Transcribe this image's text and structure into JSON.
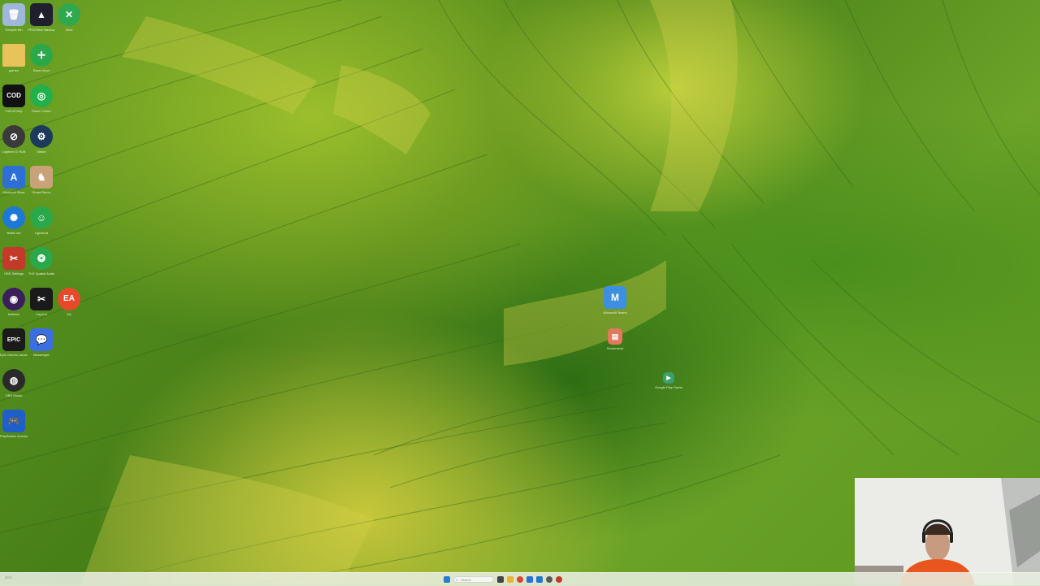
{
  "desktop": {
    "icons": [
      {
        "label": "Recycle Bin",
        "icon": "recycle-bin-icon",
        "color": "#9fb7d8",
        "glyph": "🗑"
      },
      {
        "label": "PROXMox Backup",
        "icon": "triangle-app-icon",
        "color": "#1f1f2e",
        "glyph": "▲"
      },
      {
        "label": "Xbox",
        "icon": "xbox-icon",
        "color": "#2fa84f",
        "glyph": "✕"
      },
      {
        "label": "games",
        "icon": "folder-icon",
        "color": "#e8c25a",
        "glyph": ""
      },
      {
        "label": "Razer Axon",
        "icon": "crosshair-app-icon",
        "color": "#2aa84a",
        "glyph": "✛"
      },
      {
        "label": "Call of Duty",
        "icon": "call-of-duty-icon",
        "color": "#111111",
        "glyph": "COD"
      },
      {
        "label": "Razer Cortex",
        "icon": "razer-cortex-icon",
        "color": "#22b04a",
        "glyph": "◎"
      },
      {
        "label": "Logitech G HUB",
        "icon": "circle-logo-icon",
        "color": "#3a3a3a",
        "glyph": "⊘"
      },
      {
        "label": "Steam",
        "icon": "steam-icon",
        "color": "#1b3a5c",
        "glyph": "⚙"
      },
      {
        "label": "Microsoft Store",
        "icon": "store-app-icon",
        "color": "#2e6fd6",
        "glyph": "A"
      },
      {
        "label": "Ghost Recon",
        "icon": "game-app-icon",
        "color": "#c9a27a",
        "glyph": "♞"
      },
      {
        "label": "Battle.net",
        "icon": "battle-net-icon",
        "color": "#1e78d6",
        "glyph": "✺"
      },
      {
        "label": "Lightshot",
        "icon": "smiley-app-icon",
        "color": "#2aa84a",
        "glyph": "☺"
      },
      {
        "label": "OBS Settings",
        "icon": "tools-app-icon",
        "color": "#c23b2a",
        "glyph": "✂"
      },
      {
        "label": "THX Spatial Audio",
        "icon": "thx-spatial-audio-icon",
        "color": "#2aa84a",
        "glyph": "❂"
      },
      {
        "label": "Nahimic",
        "icon": "purple-app-icon",
        "color": "#3a1f5a",
        "glyph": "◉"
      },
      {
        "label": "CapCut",
        "icon": "capcut-icon",
        "color": "#1a1a1a",
        "glyph": "✂"
      },
      {
        "label": "EA",
        "icon": "ea-icon",
        "color": "#e8492a",
        "glyph": "EA"
      },
      {
        "label": "Epic Games Launcher",
        "icon": "epic-games-icon",
        "color": "#1a1a1a",
        "glyph": "EPIC"
      },
      {
        "label": "Messenger",
        "icon": "messenger-icon",
        "color": "#3b6fe0",
        "glyph": "💬"
      },
      {
        "label": "OBS Studio",
        "icon": "obs-icon",
        "color": "#2a2a2a",
        "glyph": "◍"
      },
      {
        "label": "PlayStation Accessories",
        "icon": "playstation-icon",
        "color": "#1f5fc9",
        "glyph": "🎮"
      },
      {
        "label": "Microsoft Teams",
        "icon": "m-app-icon",
        "color": "#3d8fe0",
        "glyph": "M"
      },
      {
        "label": "Screenshot",
        "icon": "image-file-icon",
        "color": "#e07a5a",
        "glyph": "▤"
      },
      {
        "label": "Google Play Games beta",
        "icon": "google-play-icon",
        "color": "#3da06a",
        "glyph": "▶"
      }
    ]
  },
  "taskbar": {
    "left_text": "20°C",
    "search_placeholder": "Search",
    "apps": [
      {
        "icon": "windows-start-icon",
        "color": "#2b7bd6"
      },
      {
        "icon": "task-view-icon",
        "color": "#444444"
      },
      {
        "icon": "file-explorer-icon",
        "color": "#e8b43a"
      },
      {
        "icon": "chrome-icon",
        "color": "#db4437"
      },
      {
        "icon": "store-icon",
        "color": "#2e6fd6"
      },
      {
        "icon": "mail-icon",
        "color": "#1f78c9"
      },
      {
        "icon": "settings-icon",
        "color": "#5a5a5a"
      },
      {
        "icon": "obs-taskbar-icon",
        "color": "#c0392b"
      }
    ]
  }
}
